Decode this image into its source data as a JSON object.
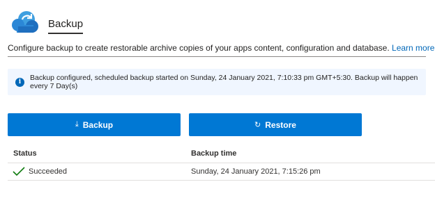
{
  "header": {
    "title": "Backup",
    "icon": "cloud-backup-icon",
    "icon_colors": {
      "cloud": "#3f9fe0",
      "cloud_dark": "#1f6fbf",
      "arrow": "#ffffff"
    }
  },
  "description": {
    "text": "Configure backup to create restorable archive copies of your apps content, configuration and database.",
    "link": "Learn more"
  },
  "info_banner": {
    "icon": "info-icon",
    "text": "Backup configured, scheduled backup started on Sunday, 24 January 2021, 7:10:33 pm GMT+5:30. Backup will happen every 7 Day(s)"
  },
  "toolbar": {
    "backup_label": "Backup",
    "backup_icon": "download-icon",
    "restore_label": "Restore",
    "restore_icon": "restore-icon",
    "accent": "#0078d4"
  },
  "table": {
    "columns": [
      "Status",
      "Backup time"
    ],
    "rows": [
      {
        "status": "Succeeded",
        "status_icon": "check-icon",
        "status_color": "#107c10",
        "time": "Sunday, 24 January 2021, 7:15:26 pm"
      }
    ]
  }
}
